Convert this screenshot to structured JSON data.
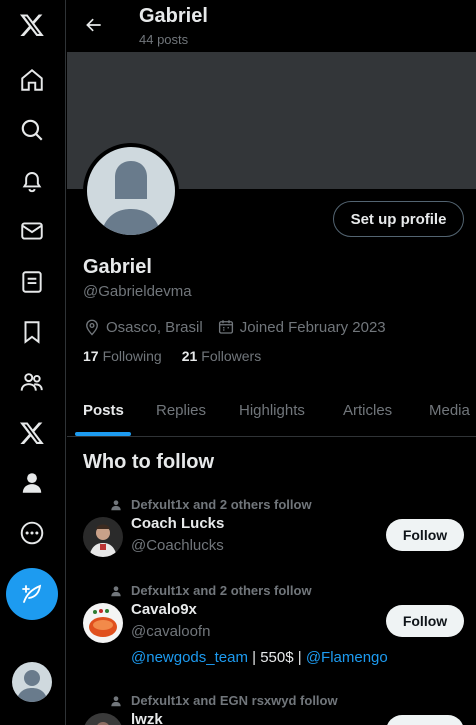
{
  "nav": {
    "items": [
      {
        "icon": "x-logo-icon"
      },
      {
        "icon": "home-icon"
      },
      {
        "icon": "search-icon"
      },
      {
        "icon": "notifications-icon"
      },
      {
        "icon": "messages-icon"
      },
      {
        "icon": "lists-icon"
      },
      {
        "icon": "bookmarks-icon"
      },
      {
        "icon": "communities-icon"
      },
      {
        "icon": "premium-x-icon"
      },
      {
        "icon": "profile-icon"
      },
      {
        "icon": "more-icon"
      }
    ],
    "post_button_icon": "compose-icon"
  },
  "header": {
    "name": "Gabriel",
    "posts_count": "44 posts"
  },
  "profile": {
    "name": "Gabriel",
    "handle": "@Gabrieldevma",
    "location": "Osasco, Brasil",
    "joined": "Joined February 2023",
    "following_count": "17",
    "following_label": "Following",
    "followers_count": "21",
    "followers_label": "Followers",
    "setup_label": "Set up profile"
  },
  "tabs": [
    {
      "label": "Posts",
      "active": true
    },
    {
      "label": "Replies",
      "active": false
    },
    {
      "label": "Highlights",
      "active": false
    },
    {
      "label": "Articles",
      "active": false
    },
    {
      "label": "Media",
      "active": false
    }
  ],
  "who_to_follow": {
    "title": "Who to follow",
    "follow_label": "Follow",
    "suggestions": [
      {
        "context": "Defxult1x and 2 others follow",
        "name": "Coach Lucks",
        "handle": "@Coachlucks",
        "bio": null
      },
      {
        "context": "Defxult1x and 2 others follow",
        "name": "Cavalo9x",
        "handle": "@cavaloofn",
        "bio_link1": "@newgods_team",
        "bio_text": " | 550$ | ",
        "bio_link2": "@Flamengo"
      },
      {
        "context": "Defxult1x and EGN rsxwyd follow",
        "name": "lwzk",
        "handle": ""
      }
    ]
  },
  "colors": {
    "accent": "#1d9bf0",
    "background": "#000000",
    "muted_text": "#71767b",
    "banner": "#333639"
  }
}
